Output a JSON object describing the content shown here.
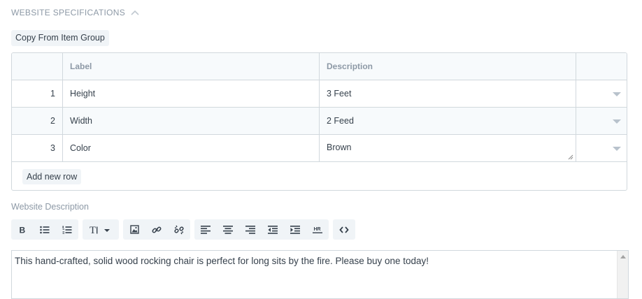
{
  "section": {
    "title": "WEBSITE SPECIFICATIONS",
    "icon": "chevron-up-icon"
  },
  "copy_button_label": "Copy From Item Group",
  "table": {
    "headers": {
      "label": "Label",
      "description": "Description"
    },
    "rows": [
      {
        "idx": "1",
        "label": "Height",
        "description": "3 Feet"
      },
      {
        "idx": "2",
        "label": "Width",
        "description": "2 Feed"
      },
      {
        "idx": "3",
        "label": "Color",
        "description": "Brown"
      }
    ],
    "add_row_label": "Add new row"
  },
  "description": {
    "label": "Website Description",
    "content": "This hand-crafted, solid wood rocking chair is perfect for long sits by the fire.  Please buy one today!"
  },
  "toolbar": {
    "groups": [
      [
        "bold-icon",
        "bullet-list-icon",
        "numbered-list-icon"
      ],
      [
        "text-size-icon"
      ],
      [
        "image-icon",
        "link-icon",
        "unlink-icon"
      ],
      [
        "align-left-icon",
        "align-center-icon",
        "align-right-icon",
        "outdent-icon",
        "indent-icon",
        "horizontal-rule-icon"
      ],
      [
        "code-view-icon"
      ]
    ]
  },
  "colors": {
    "border": "#d1d8dd",
    "muted_text": "#8d99a6",
    "button_bg": "#f0f4f7",
    "row_alt_bg": "#f7fafc",
    "text": "#36414c"
  }
}
